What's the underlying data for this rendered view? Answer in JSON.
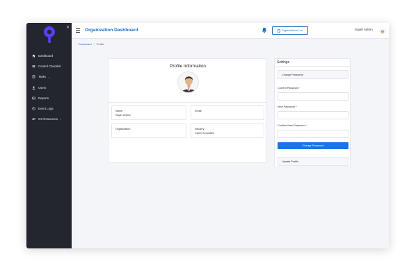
{
  "topbar": {
    "title": "Organization Dashboard",
    "org_button_label": "Organizations List",
    "user_name": "Super Admin"
  },
  "sidebar": {
    "items": [
      {
        "label": "Dashboard",
        "icon": "home-icon"
      },
      {
        "label": "Control Checklist",
        "icon": "checklist-icon"
      },
      {
        "label": "Tasks",
        "icon": "tasks-icon",
        "has_dropdown": true
      },
      {
        "label": "Users",
        "icon": "user-icon"
      },
      {
        "label": "Reports",
        "icon": "reports-icon"
      },
      {
        "label": "Event Logs",
        "icon": "clock-icon"
      },
      {
        "label": "OS Resources",
        "icon": "link-icon",
        "has_dropdown": true
      }
    ]
  },
  "breadcrumb": {
    "home": "Dashboard",
    "separator": "/",
    "current": "Profile"
  },
  "profile": {
    "title": "Profile Information",
    "fields": [
      {
        "label": "Name",
        "value": "Super Admin"
      },
      {
        "label": "Email",
        "value": ""
      },
      {
        "label": "Organization",
        "value": ""
      },
      {
        "label": "Industry",
        "value": "Cyber Securities"
      }
    ]
  },
  "settings": {
    "title": "Settings",
    "change_password_header": "Change Password",
    "current_password_label": "Current Password",
    "new_password_label": "New Password",
    "confirm_password_label": "Confirm New Password",
    "required_mark": "*",
    "change_password_button": "Change Password",
    "update_profile_label": "Update Profile"
  },
  "colors": {
    "sidebar_bg": "#23262e",
    "accent": "#1c6fc5",
    "primary_button": "#1a73e8",
    "logo": "#5b3df5"
  }
}
